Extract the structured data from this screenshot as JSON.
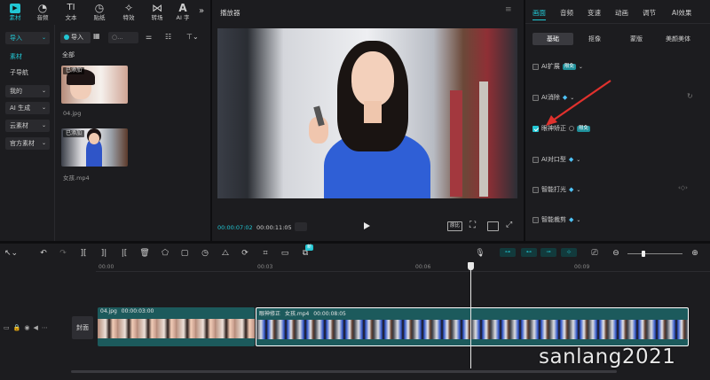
{
  "toolbar": {
    "tabs": [
      {
        "label": "素材",
        "icon": "media-icon",
        "glyph": "▶"
      },
      {
        "label": "音频",
        "icon": "audio-icon",
        "glyph": "◔"
      },
      {
        "label": "文本",
        "icon": "text-icon",
        "glyph": "TI"
      },
      {
        "label": "贴纸",
        "icon": "sticker-icon",
        "glyph": "◷"
      },
      {
        "label": "特效",
        "icon": "effects-icon",
        "glyph": "✧"
      },
      {
        "label": "转场",
        "icon": "transition-icon",
        "glyph": "⋈"
      },
      {
        "label": "AI 字",
        "icon": "ai-text-icon",
        "glyph": "A"
      }
    ],
    "more": "»"
  },
  "left": {
    "import_dropdown": "导入",
    "import_button": "导入",
    "category_all": "全部",
    "sidebar": [
      "素材",
      "子导航",
      "我的",
      "AI 生成",
      "云素材",
      "官方素材"
    ],
    "media": [
      {
        "badge": "已添加",
        "name": "04.jpg"
      },
      {
        "badge": "已添加",
        "name": "女孩.mp4"
      }
    ]
  },
  "player": {
    "title": "播放器",
    "current_time": "00:00:07:02",
    "total_time": "00:00:11:05",
    "ratio_label": "原比",
    "menu": "≡"
  },
  "right": {
    "tabs": [
      "画面",
      "音频",
      "变速",
      "动画",
      "调节",
      "AI效果"
    ],
    "active_tab": "画面",
    "subtabs": [
      "基础",
      "抠像",
      "蒙版",
      "美颜美体"
    ],
    "props": [
      {
        "label": "AI扩展",
        "badge": "限免",
        "checked": false
      },
      {
        "label": "AI消除",
        "badge": "",
        "checked": false
      },
      {
        "label": "眼神矫正",
        "badge": "限免",
        "checked": true
      },
      {
        "label": "AI对口型",
        "badge": "",
        "checked": false
      },
      {
        "label": "智能打光",
        "badge": "",
        "checked": false
      },
      {
        "label": "智能裁剪",
        "badge": "",
        "checked": false
      }
    ]
  },
  "timeline": {
    "ruler": [
      "00:00",
      "00:03",
      "00:06",
      "00:09"
    ],
    "cover_label": "封面",
    "new_badge": "新",
    "clip1": {
      "name": "04.jpg",
      "duration": "00:00:03:00"
    },
    "clip2": {
      "effect": "眼神修正",
      "name": "女孩.mp4",
      "duration": "00:00:08:05"
    }
  },
  "watermark": "sanlang2021",
  "colors": {
    "accent": "#22c6d3",
    "arrow": "#e0312d",
    "clip_bg": "#1c5a5c"
  }
}
